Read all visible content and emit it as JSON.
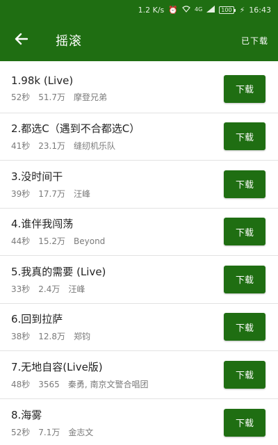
{
  "statusbar": {
    "speed": "1.2 K/s",
    "network": "4G",
    "battery": "100",
    "time": "16:43"
  },
  "appbar": {
    "title": "摇滚",
    "downloaded_label": "已下载",
    "back_icon": "arrow-left-icon"
  },
  "songs": [
    {
      "title": "1.98k (Live)",
      "duration": "52秒",
      "plays": "51.7万",
      "artist": "摩登兄弟",
      "button": "下载"
    },
    {
      "title": "2.都选C（遇到不合都选C）",
      "duration": "41秒",
      "plays": "23.1万",
      "artist": "缝纫机乐队",
      "button": "下载"
    },
    {
      "title": "3.没时间干",
      "duration": "39秒",
      "plays": "17.7万",
      "artist": "汪峰",
      "button": "下载"
    },
    {
      "title": "4.谁伴我闯荡",
      "duration": "44秒",
      "plays": "15.2万",
      "artist": "Beyond",
      "button": "下载"
    },
    {
      "title": "5.我真的需要 (Live)",
      "duration": "33秒",
      "plays": "2.4万",
      "artist": "汪峰",
      "button": "下载"
    },
    {
      "title": "6.回到拉萨",
      "duration": "38秒",
      "plays": "12.8万",
      "artist": "郑钧",
      "button": "下载"
    },
    {
      "title": "7.无地自容(Live版)",
      "duration": "48秒",
      "plays": "3565",
      "artist": "秦勇, 南京文警合唱团",
      "button": "下载"
    },
    {
      "title": "8.海雾",
      "duration": "52秒",
      "plays": "7.1万",
      "artist": "金志文",
      "button": "下载"
    }
  ],
  "colors": {
    "primary": "#1f6e12",
    "text": "#222222",
    "meta": "#7a7a7a"
  }
}
